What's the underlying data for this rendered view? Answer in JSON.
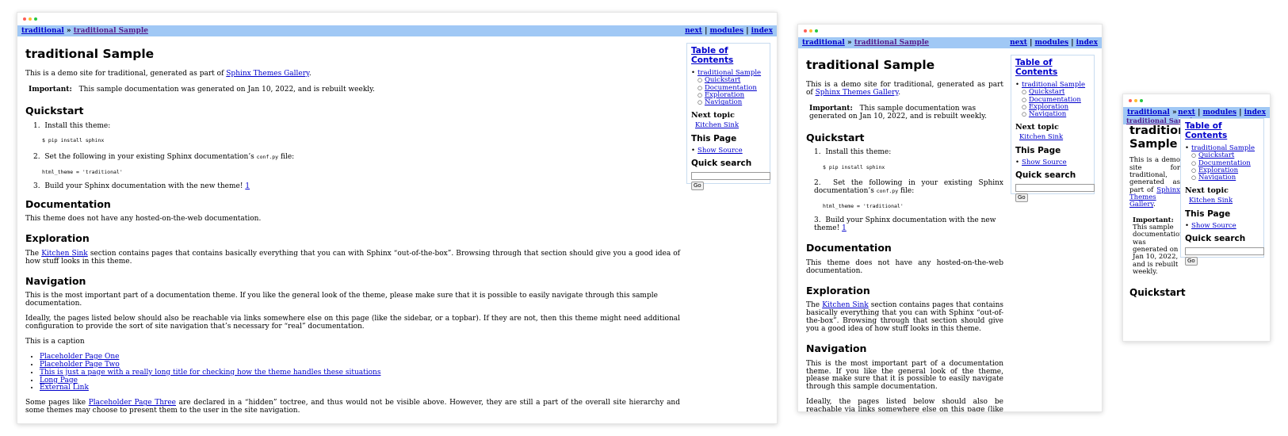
{
  "nav": {
    "parent": "traditional",
    "separator": "»",
    "current": "traditional Sample",
    "next": "next",
    "modules": "modules",
    "index": "index",
    "pipe": "|"
  },
  "page": {
    "title": "traditional Sample",
    "intro_prefix": "This is a demo site for traditional, generated as part of ",
    "intro_link": "Sphinx Themes Gallery",
    "intro_suffix": ".",
    "important_label": "Important:",
    "important_text": "This sample documentation was generated on Jan 10, 2022, and is rebuilt weekly.",
    "quickstart_title": "Quickstart",
    "step1": "Install this theme:",
    "step1_code": "$ pip install sphinx",
    "step2_prefix": "Set the following in your existing Sphinx documentation’s ",
    "step2_code": "conf.py",
    "step2_suffix": " file:",
    "step2_code_block": "html_theme = 'traditional'",
    "step3": "Build your Sphinx documentation with the new theme! ",
    "footnote_ref": "1",
    "documentation_title": "Documentation",
    "documentation_text": "This theme does not have any hosted-on-the-web documentation.",
    "exploration_title": "Exploration",
    "exploration_prefix": "The ",
    "exploration_link": "Kitchen Sink",
    "exploration_suffix": " section contains pages that contains basically everything that you can with Sphinx “out-of-the-box”. Browsing through that section should give you a good idea of how stuff looks in this theme.",
    "navigation_title": "Navigation",
    "navigation_p1": "This is the most important part of a documentation theme. If you like the general look of the theme, please make sure that it is possible to easily navigate through this sample documentation.",
    "navigation_p2": "Ideally, the pages listed below should also be reachable via links somewhere else on this page (like the sidebar, or a topbar). If they are not, then this theme might need additional configuration to provide the sort of site navigation that’s necessary for “real” documentation.",
    "caption": "This is a caption",
    "toc_pages": [
      "Placeholder Page One",
      "Placeholder Page Two",
      "This is just a page with a really long title for checking how the theme handles these situations",
      "Long Page",
      "External Link"
    ],
    "hidden_prefix": "Some pages like ",
    "hidden_link": "Placeholder Page Three",
    "hidden_suffix": " are declared in a “hidden” toctree, and thus would not be visible above. However, they are still a part of the overall site hierarchy and some themes may choose to present them to the user in the site navigation.",
    "footnote_marker": "1"
  },
  "sidebar": {
    "toc_title": "Table of Contents",
    "toc_root": "traditional Sample",
    "toc_items": [
      "Quickstart",
      "Documentation",
      "Exploration",
      "Navigation"
    ],
    "next_topic_title": "Next topic",
    "next_topic_link": "Kitchen Sink",
    "this_page_title": "This Page",
    "show_source": "Show Source",
    "quick_search_title": "Quick search",
    "go_button": "Go"
  },
  "colors": {
    "relbar": "#a0c8f5",
    "link": "#0000cc",
    "visited": "#551a8b"
  }
}
